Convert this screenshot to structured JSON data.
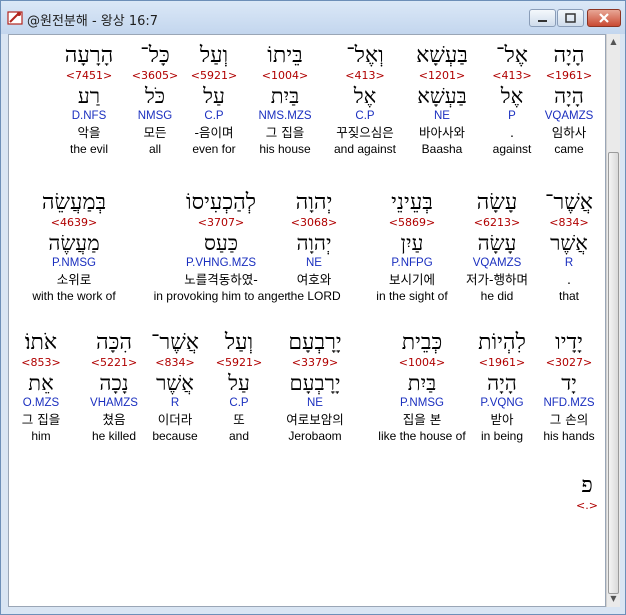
{
  "window": {
    "title": "@원전분해 - 왕상 16:7",
    "icon": "bible-app-icon"
  },
  "verse_rows": [
    [
      {
        "heb": "הָיָה",
        "code": "<1961>",
        "lemma": "הָיָה",
        "morph": "VQAMZS",
        "ko": "임하사",
        "en": "came"
      },
      {
        "heb": "אֶל־",
        "code": "<413>",
        "lemma": "אֶל",
        "morph": "P",
        "ko": ".",
        "en": "against"
      },
      {
        "heb": "בַּעְשָׁא",
        "code": "<1201>",
        "lemma": "בַּעְשָׁא",
        "morph": "NE",
        "ko": "바아사와",
        "en": "Baasha"
      },
      {
        "heb": "וְאֶל־",
        "code": "<413>",
        "lemma": "אֶל",
        "morph": "C.P",
        "ko": "꾸짖으심은",
        "en": "and against"
      },
      {
        "heb": "בֵּיתוֹ",
        "code": "<1004>",
        "lemma": "בַּיִת",
        "morph": "NMS.MZS",
        "ko": "그 집을",
        "en": "his house"
      },
      {
        "heb": "וְעַל",
        "code": "<5921>",
        "lemma": "עַל",
        "morph": "C.P",
        "ko": "-음이며",
        "en": "even for"
      },
      {
        "heb": "כָּל־",
        "code": "<3605>",
        "lemma": "כֹּל",
        "morph": "NMSG",
        "ko": "모든",
        "en": "all"
      },
      {
        "heb": "הָרָעָה",
        "code": "<7451>",
        "lemma": "רַע",
        "morph": "D.NFS",
        "ko": "악을",
        "en": "the evil"
      }
    ],
    [
      {
        "heb": "אֲשֶׁר־",
        "code": "<834>",
        "lemma": "אֲשֶׁר",
        "morph": "R",
        "ko": ".",
        "en": "that"
      },
      {
        "heb": "עָשָׂה",
        "code": "<6213>",
        "lemma": "עָשָׂה",
        "morph": "VQAMZS",
        "ko": "저가-행하며",
        "en": "he did"
      },
      {
        "heb": "בְּעֵינֵי",
        "code": "<5869>",
        "lemma": "עַיִן",
        "morph": "P.NFPG",
        "ko": "보시기에",
        "en": "in the sight of"
      },
      {
        "heb": "יְהוָה",
        "code": "<3068>",
        "lemma": "יְהוָה",
        "morph": "NE",
        "ko": "여호와",
        "en": "the LORD"
      },
      {
        "heb": "לְהַכְעִיסוֹ",
        "code": "<3707>",
        "lemma": "כַּעַס",
        "morph": "P.VHNG.MZS",
        "ko": "노를격동하였-",
        "en": "in provoking him to anger"
      },
      {
        "heb": "בְּמַעֲשֵׂה",
        "code": "<4639>",
        "lemma": "מַעֲשֶׂה",
        "morph": "P.NMSG",
        "ko": "소위로",
        "en": "with the work of"
      }
    ],
    [
      {
        "heb": "יָדָיו",
        "code": "<3027>",
        "lemma": "יָד",
        "morph": "NFD.MZS",
        "ko": "그 손의",
        "en": "his hands"
      },
      {
        "heb": "לִהְיוֹת",
        "code": "<1961>",
        "lemma": "הָיָה",
        "morph": "P.VQNG",
        "ko": "받아",
        "en": "in being"
      },
      {
        "heb": "כְּבֵית",
        "code": "<1004>",
        "lemma": "בַּיִת",
        "morph": "P.NMSG",
        "ko": "집을 본",
        "en": "like the house of"
      },
      {
        "heb": "יָרָבְעָם",
        "code": "<3379>",
        "lemma": "יָרָבְעָם",
        "morph": "NE",
        "ko": "여로보암의",
        "en": "Jerobaom"
      },
      {
        "heb": "וְעַל",
        "code": "<5921>",
        "lemma": "עַל",
        "morph": "C.P",
        "ko": "또",
        "en": "and"
      },
      {
        "heb": "אֲשֶׁר־",
        "code": "<834>",
        "lemma": "אֲשֶׁר",
        "morph": "R",
        "ko": "이더라",
        "en": "because"
      },
      {
        "heb": "הִכָּה",
        "code": "<5221>",
        "lemma": "נָכָה",
        "morph": "VHAMZS",
        "ko": "쳤음",
        "en": "he killed"
      },
      {
        "heb": "אֹתוֹ׃",
        "code": "<853>",
        "lemma": "אֵת",
        "morph": "O.MZS",
        "ko": "그 집을",
        "en": "him"
      }
    ],
    [
      {
        "heb": "פ",
        "code": "<.>"
      }
    ]
  ]
}
